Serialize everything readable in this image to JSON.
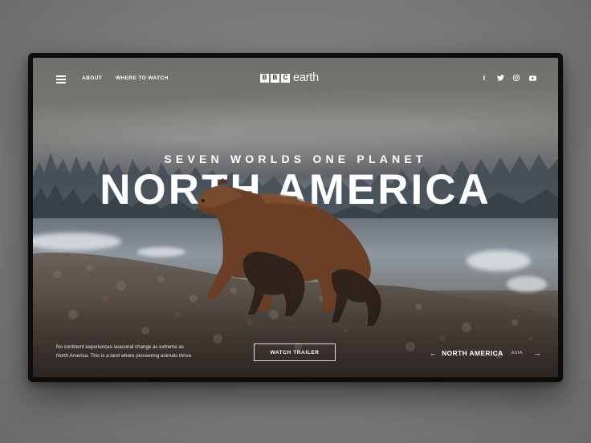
{
  "nav": {
    "menu_icon": "hamburger-icon",
    "links": [
      "ABOUT",
      "WHERE TO WATCH"
    ],
    "logo": {
      "boxes": [
        "B",
        "B",
        "C"
      ],
      "wordmark": "earth"
    },
    "social": [
      {
        "name": "facebook-icon",
        "glyph": "f"
      },
      {
        "name": "twitter-icon",
        "glyph": "twitter"
      },
      {
        "name": "instagram-icon",
        "glyph": "instagram"
      },
      {
        "name": "youtube-icon",
        "glyph": "youtube"
      }
    ]
  },
  "hero": {
    "subtitle": "SEVEN WORLDS ONE PLANET",
    "title": "NORTH AMERICA"
  },
  "footer": {
    "description_line1": "No continent experiences seasonal change as extreme as",
    "description_line2": "North America.  This is a land where pioneering animals thrive.",
    "trailer_button": "WATCH TRAILER",
    "current_region": "NORTH AMERICA",
    "next_region": "ASIA",
    "prev_arrow": "←",
    "next_arrow": "→"
  },
  "colors": {
    "frame": "#0d0d0d",
    "text": "#ffffff",
    "bear": "#6b3f25"
  }
}
